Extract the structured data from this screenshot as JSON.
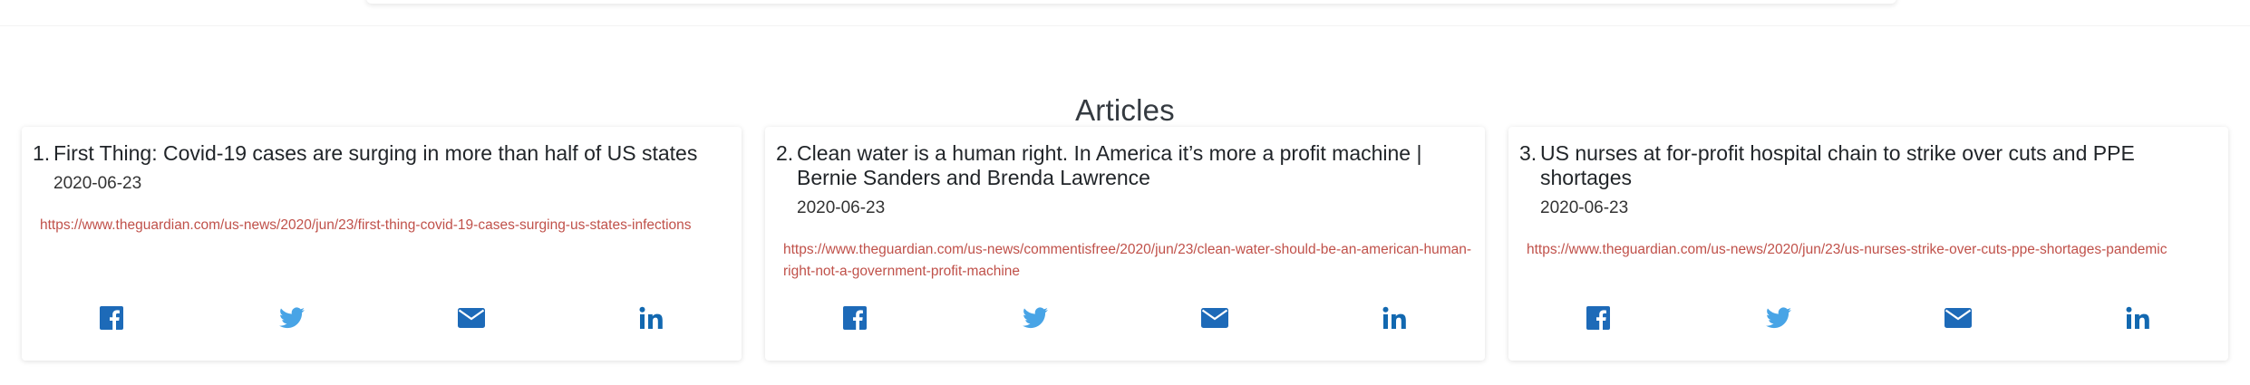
{
  "section": {
    "title": "Articles"
  },
  "colors": {
    "link": "#c0514a",
    "facebook": "#1d6ab8",
    "twitter": "#48a4e6",
    "email": "#1d6ab8",
    "linkedin": "#1268b0"
  },
  "share_icons": [
    "facebook-icon",
    "twitter-icon",
    "email-icon",
    "linkedin-icon"
  ],
  "articles": [
    {
      "number": "1.",
      "title": "First Thing: Covid-19 cases are surging in more than half of US states",
      "date": "2020-06-23",
      "url": "https://www.theguardian.com/us-news/2020/jun/23/first-thing-covid-19-cases-surging-us-states-infections"
    },
    {
      "number": "2.",
      "title": "Clean water is a human right. In America it’s more a profit machine | Bernie Sanders and Brenda Lawrence",
      "date": "2020-06-23",
      "url": "https://www.theguardian.com/us-news/commentisfree/2020/jun/23/clean-water-should-be-an-american-human-right-not-a-government-profit-machine"
    },
    {
      "number": "3.",
      "title": "US nurses at for-profit hospital chain to strike over cuts and PPE shortages",
      "date": "2020-06-23",
      "url": "https://www.theguardian.com/us-news/2020/jun/23/us-nurses-strike-over-cuts-ppe-shortages-pandemic"
    }
  ]
}
